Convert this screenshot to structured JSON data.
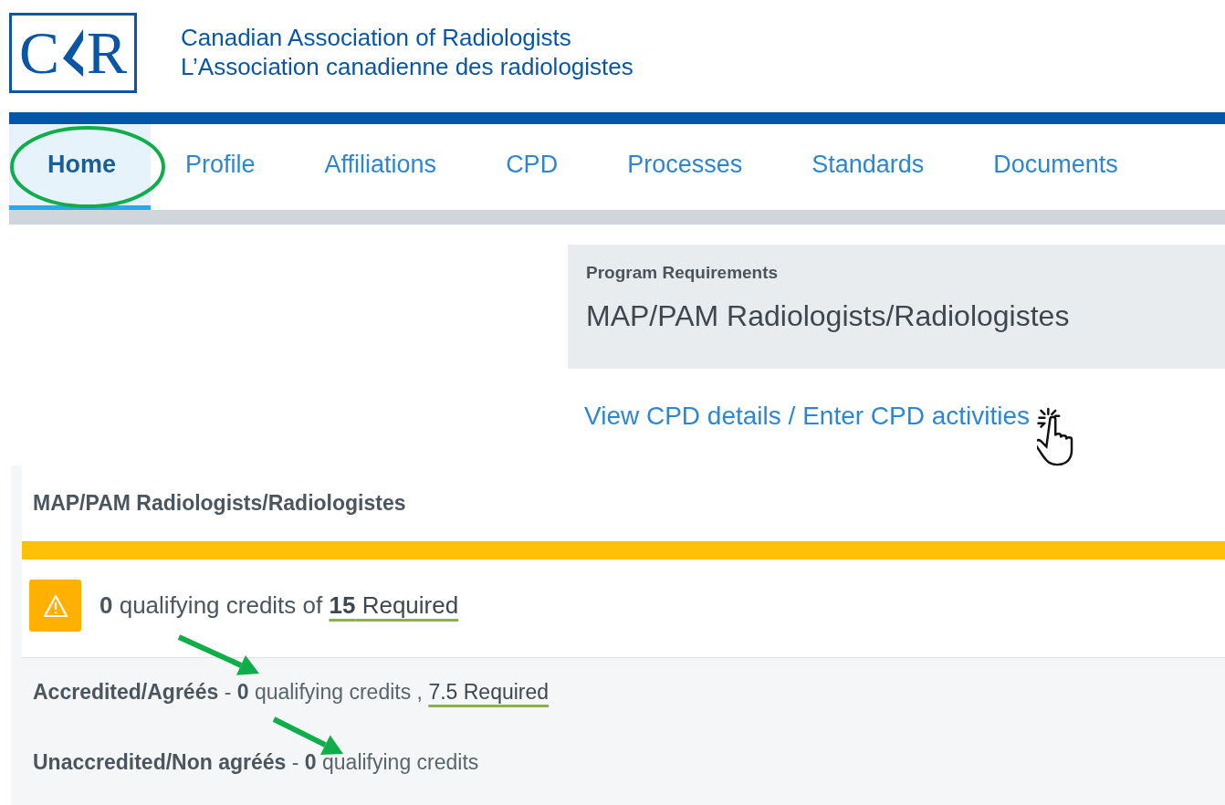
{
  "header": {
    "logo": {
      "letters": [
        "C",
        "R"
      ]
    },
    "title_lines": [
      "Canadian Association of Radiologists",
      "L’Association canadienne des radiologistes"
    ]
  },
  "nav": {
    "tabs": [
      {
        "label": "Home",
        "selected": true
      },
      {
        "label": "Profile",
        "selected": false
      },
      {
        "label": "Affiliations",
        "selected": false
      },
      {
        "label": "CPD",
        "selected": false
      },
      {
        "label": "Processes",
        "selected": false
      },
      {
        "label": "Standards",
        "selected": false
      },
      {
        "label": "Documents",
        "selected": false
      }
    ]
  },
  "program": {
    "caption": "Program Requirements",
    "title": "MAP/PAM Radiologists/Radiologistes",
    "link": "View CPD details / Enter CPD activities"
  },
  "credits": {
    "title": "MAP/PAM Radiologists/Radiologistes",
    "summary": {
      "text": "**0** qualifying credits of",
      "link": "**15** Required"
    },
    "rows": [
      {
        "text": "**Accredited/Agréés** - **0** qualifying credits ,",
        "link": "7.5 Required"
      },
      {
        "text": "**Unaccredited/Non agréés** - **0** qualifying credits"
      }
    ]
  }
}
